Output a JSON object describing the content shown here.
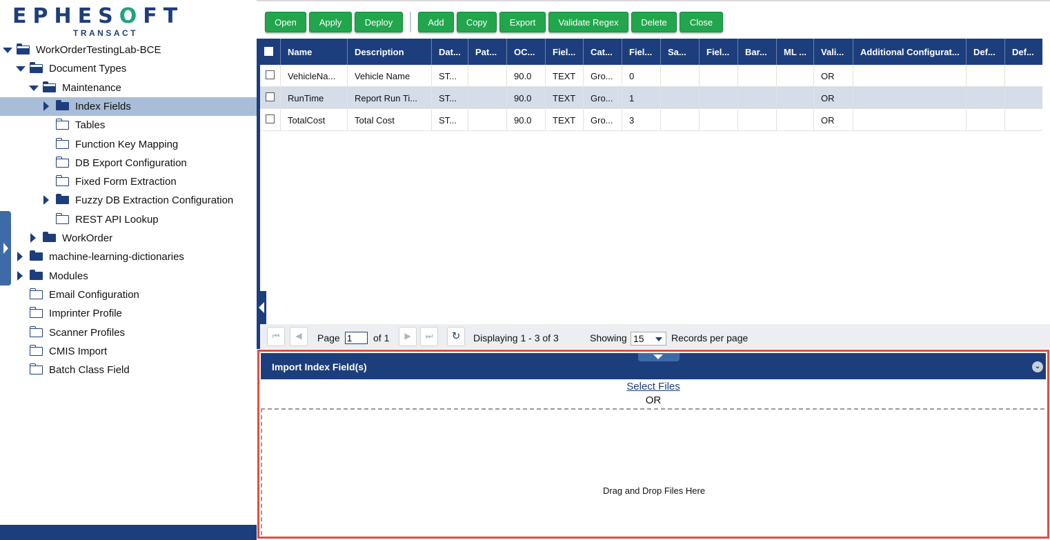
{
  "logo": {
    "brand_left": "EPHES",
    "brand_accent": "O",
    "brand_right": "FT",
    "sub": "TRANSACT"
  },
  "tree": {
    "items": [
      {
        "label": "WorkOrderTestingLab-BCE",
        "icon": "folder-open-icon",
        "toggle": "down"
      },
      {
        "label": "Document Types",
        "icon": "folder-open-icon",
        "toggle": "down"
      },
      {
        "label": "Maintenance",
        "icon": "folder-open-icon",
        "toggle": "down"
      },
      {
        "label": "Index Fields",
        "icon": "folder-icon",
        "toggle": "right",
        "selected": true
      },
      {
        "label": "Tables",
        "icon": "folder-empty-icon"
      },
      {
        "label": "Function Key Mapping",
        "icon": "folder-empty-icon"
      },
      {
        "label": "DB Export Configuration",
        "icon": "folder-empty-icon"
      },
      {
        "label": "Fixed Form Extraction",
        "icon": "folder-empty-icon"
      },
      {
        "label": "Fuzzy DB Extraction Configuration",
        "icon": "folder-icon",
        "toggle": "right"
      },
      {
        "label": "REST API Lookup",
        "icon": "folder-empty-icon"
      },
      {
        "label": "WorkOrder",
        "icon": "folder-icon",
        "toggle": "right"
      },
      {
        "label": "machine-learning-dictionaries",
        "icon": "folder-icon",
        "toggle": "right"
      },
      {
        "label": "Modules",
        "icon": "folder-icon",
        "toggle": "right"
      },
      {
        "label": "Email Configuration",
        "icon": "folder-empty-icon"
      },
      {
        "label": "Imprinter Profile",
        "icon": "folder-empty-icon"
      },
      {
        "label": "Scanner Profiles",
        "icon": "folder-empty-icon"
      },
      {
        "label": "CMIS Import",
        "icon": "folder-empty-icon"
      },
      {
        "label": "Batch Class Field",
        "icon": "folder-empty-icon"
      }
    ]
  },
  "toolbar": {
    "open": "Open",
    "apply": "Apply",
    "deploy": "Deploy",
    "add": "Add",
    "copy": "Copy",
    "export": "Export",
    "validate_regex": "Validate Regex",
    "delete": "Delete",
    "close": "Close"
  },
  "grid": {
    "columns": [
      "Name",
      "Description",
      "Dat...",
      "Pat...",
      "OC...",
      "Fiel...",
      "Cat...",
      "Fiel...",
      "Sa...",
      "Fiel...",
      "Bar...",
      "ML ...",
      "Vali...",
      "Additional Configurat...",
      "Def...",
      "Def..."
    ],
    "rows": [
      [
        "VehicleNa...",
        "Vehicle Name",
        "ST...",
        "",
        "90.0",
        "TEXT",
        "Gro...",
        "0",
        "",
        "",
        "",
        "",
        "OR",
        "",
        "",
        ""
      ],
      [
        "RunTime",
        "Report Run Ti...",
        "ST...",
        "",
        "90.0",
        "TEXT",
        "Gro...",
        "1",
        "",
        "",
        "",
        "",
        "OR",
        "",
        "",
        ""
      ],
      [
        "TotalCost",
        "Total Cost",
        "ST...",
        "",
        "90.0",
        "TEXT",
        "Gro...",
        "3",
        "",
        "",
        "",
        "",
        "OR",
        "",
        "",
        ""
      ]
    ]
  },
  "pager": {
    "page_label": "Page",
    "page_value": "1",
    "of_label": "of 1",
    "displaying": "Displaying 1 - 3 of 3",
    "showing_label": "Showing",
    "per_page_value": "15",
    "records_label": "Records per page"
  },
  "import_panel": {
    "title": "Import Index Field(s)",
    "select_files": "Select Files",
    "or": "OR",
    "drop_text": "Drag and Drop Files Here"
  },
  "colors": {
    "primary": "#1d3e7c",
    "button": "#21a64d",
    "highlight": "#e74c3c",
    "selected_row": "#a9bdd8"
  }
}
